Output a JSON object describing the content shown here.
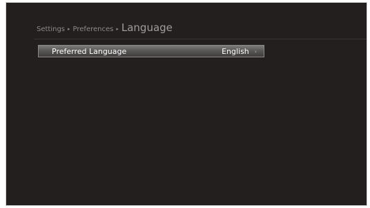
{
  "breadcrumb": {
    "level1": "Settings",
    "level2": "Preferences",
    "current": "Language",
    "separator": "▸"
  },
  "menu": {
    "items": [
      {
        "label": "Preferred Language",
        "value": "English",
        "chevron": "›"
      }
    ]
  },
  "colors": {
    "background": "#231f1e",
    "highlight_top": "#7d7a7a",
    "highlight_bottom": "#3f3c3c"
  }
}
